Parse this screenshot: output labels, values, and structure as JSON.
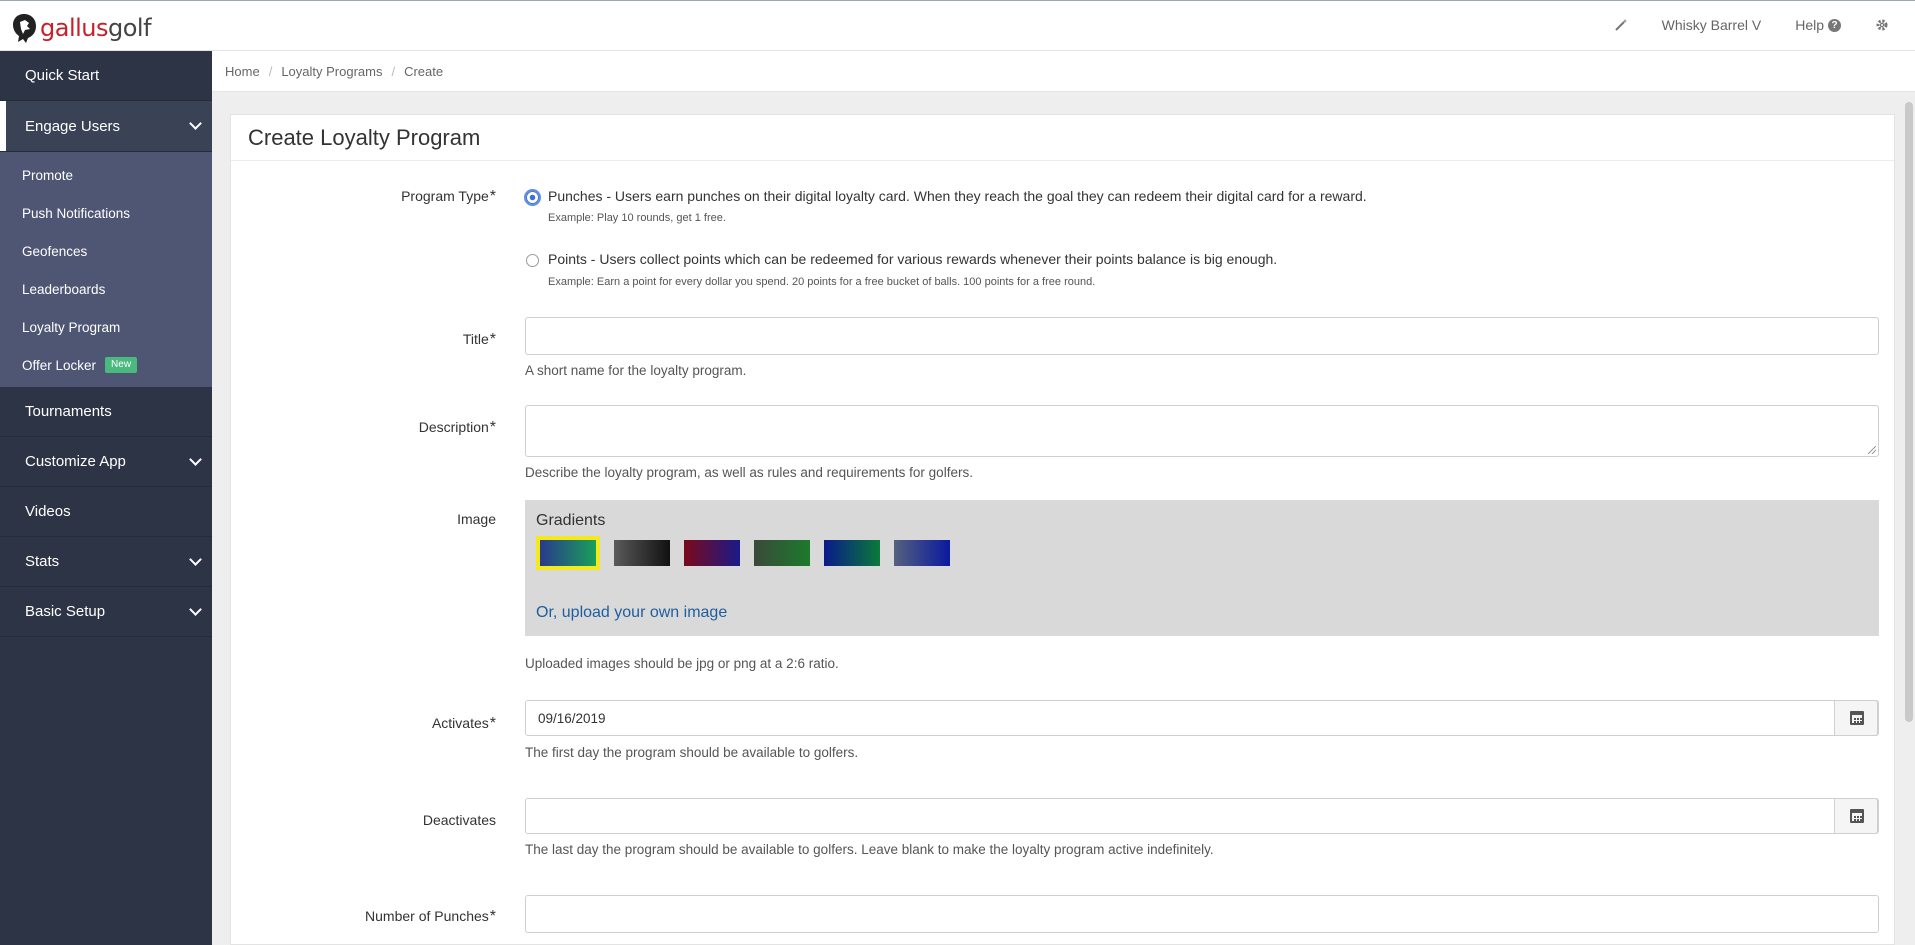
{
  "brand": {
    "part1": "gallus",
    "part2": "golf"
  },
  "topbar": {
    "account": "Whisky Barrel V",
    "help": "Help"
  },
  "sidebar": {
    "items": [
      {
        "label": "Quick Start"
      },
      {
        "label": "Engage Users",
        "expanded": true
      },
      {
        "label": "Tournaments"
      },
      {
        "label": "Customize App"
      },
      {
        "label": "Videos"
      },
      {
        "label": "Stats"
      },
      {
        "label": "Basic Setup"
      }
    ],
    "submenu": [
      {
        "label": "Promote"
      },
      {
        "label": "Push Notifications"
      },
      {
        "label": "Geofences"
      },
      {
        "label": "Leaderboards"
      },
      {
        "label": "Loyalty Program"
      },
      {
        "label": "Offer Locker",
        "badge": "New"
      }
    ]
  },
  "breadcrumb": [
    "Home",
    "Loyalty Programs",
    "Create"
  ],
  "page": {
    "title": "Create Loyalty Program"
  },
  "form": {
    "program_type": {
      "label": "Program Type",
      "options": [
        {
          "text": "Punches - Users earn punches on their digital loyalty card. When they reach the goal they can redeem their digital card for a reward.",
          "example": "Example: Play 10 rounds, get 1 free.",
          "checked": true
        },
        {
          "text": "Points - Users collect points which can be redeemed for various rewards whenever their points balance is big enough.",
          "example": "Example: Earn a point for every dollar you spend. 20 points for a free bucket of balls. 100 points for a free round.",
          "checked": false
        }
      ]
    },
    "title": {
      "label": "Title",
      "value": "",
      "help": "A short name for the loyalty program."
    },
    "description": {
      "label": "Description",
      "value": "",
      "help": "Describe the loyalty program, as well as rules and requirements for golfers."
    },
    "image": {
      "label": "Image",
      "gradients_title": "Gradients",
      "gradients": [
        {
          "from": "#2a3a8c",
          "to": "#18a05a",
          "selected": true
        },
        {
          "from": "#5a5a5a",
          "to": "#111111",
          "selected": false
        },
        {
          "from": "#7a0a1a",
          "to": "#1a1a8a",
          "selected": false
        },
        {
          "from": "#3a4a3a",
          "to": "#1c7a2c",
          "selected": false
        },
        {
          "from": "#0a1a8a",
          "to": "#0a7a3a",
          "selected": false
        },
        {
          "from": "#56607e",
          "to": "#0a1aa0",
          "selected": false
        }
      ],
      "upload_link": "Or, upload your own image",
      "help": "Uploaded images should be jpg or png at a 2:6 ratio."
    },
    "activates": {
      "label": "Activates",
      "value": "09/16/2019",
      "help": "The first day the program should be available to golfers."
    },
    "deactivates": {
      "label": "Deactivates",
      "value": "",
      "help": "The last day the program should be available to golfers. Leave blank to make the loyalty program active indefinitely."
    },
    "punches": {
      "label": "Number of Punches",
      "value": ""
    }
  },
  "colors": {
    "sidebar": "#2c3445",
    "submenu": "#4e5673",
    "link": "#1e5e9e",
    "badge": "#49b97e",
    "selected_outline": "#f5e81c"
  }
}
